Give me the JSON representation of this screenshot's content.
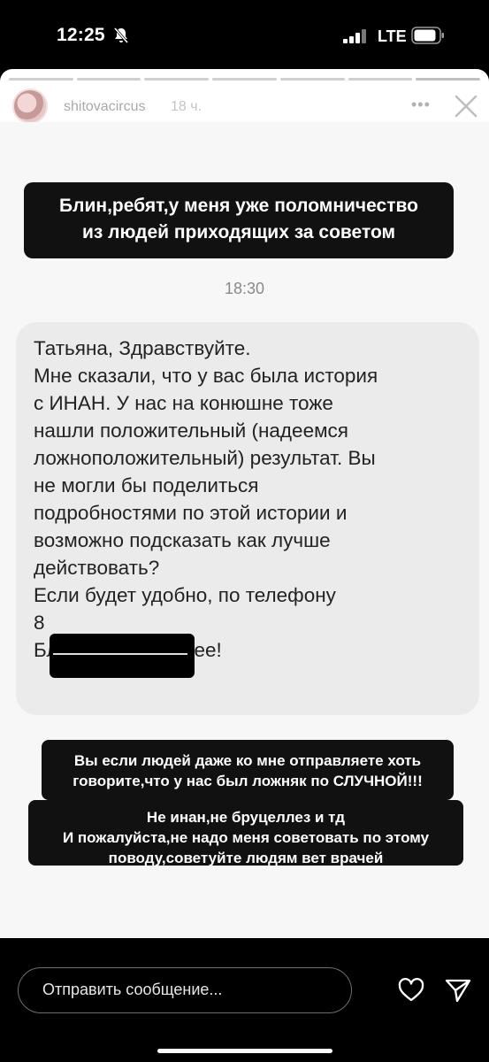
{
  "status_bar": {
    "time": "12:25",
    "network": "LTE"
  },
  "story": {
    "username": "shitovacircus",
    "posted_ago": "18 ч.",
    "more_label": "•••",
    "progress_segments": 7,
    "sticker_top_lines": [
      "Блин,ребят,у меня уже поломничество",
      "из людей приходящих за советом"
    ],
    "message_time": "18:30",
    "message_lines": [
      "Татьяна, Здравствуйте.",
      "Мне сказали, что у вас была история",
      "с ИНАН. У нас на конюшне тоже",
      "нашли положительный (надеемся",
      "ложноположительный) результат. Вы",
      "не могли бы поделиться",
      "подробностями по этой истории и",
      "возможно подсказать как лучше",
      "действовать?",
      "Если будет удобно, по телефону",
      "8",
      "Благодарю заранее!"
    ],
    "sticker_bottom_lines_a": [
      "Вы если людей даже ко мне отправляете хоть",
      "говорите,что у нас был ложняк по СЛУЧНОЙ!!!"
    ],
    "sticker_bottom_lines_b": [
      "Не инан,не бруцеллез и тд",
      "И пожалуйста,не надо меня советовать по этому",
      "поводу,советуйте людям вет врачей"
    ]
  },
  "reply_bar": {
    "placeholder": "Отправить сообщение..."
  },
  "colors": {
    "background": "#000000",
    "card": "#ffffff",
    "bubble": "#ebebeb",
    "sticker": "#111111"
  }
}
